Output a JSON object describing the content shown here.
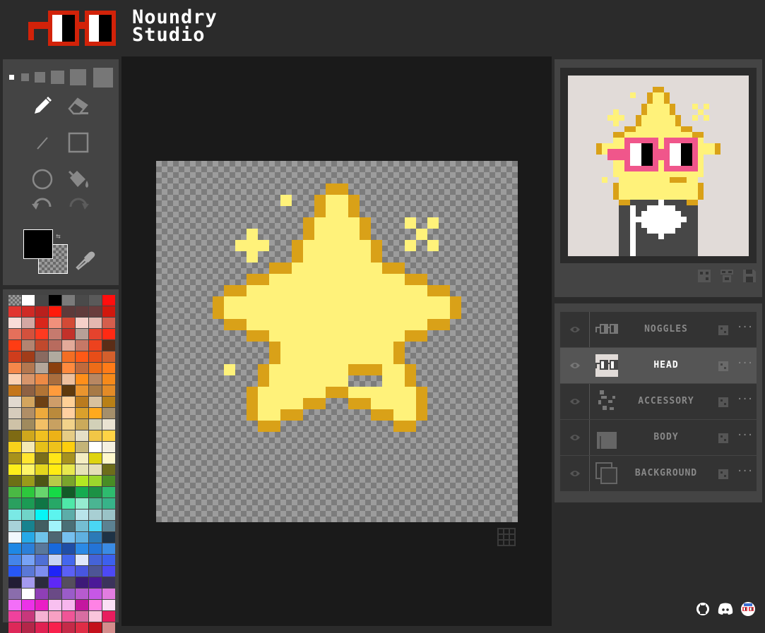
{
  "app": {
    "logo_line1": "Noundry",
    "logo_line2": "Studio",
    "logo_icon": "noggles-logo"
  },
  "toolbox": {
    "brush_sizes": 6,
    "selected_brush_size": 1,
    "tools": [
      "pencil-icon",
      "eraser-icon",
      "line-icon",
      "rectangle-icon",
      "circle-icon",
      "fill-bucket-icon",
      "undo-icon",
      "redo-icon"
    ],
    "selected_tool": "pencil-icon",
    "primary_color": "#000000",
    "secondary_color": "transparent"
  },
  "palette": {
    "colors": [
      "transparent",
      "#ffffff",
      "#474747",
      "#000000",
      "#7b7b7b",
      "#4a4a4a",
      "#5a5a5a",
      "#ff0e0e",
      "#e1352f",
      "#cf2a25",
      "#b9201d",
      "#ff1a0b",
      "#5d3a3a",
      "#603b3b",
      "#6a3c3c",
      "#d1180d",
      "#f8ddd8",
      "#d4a8a3",
      "#d9261b",
      "#f0907b",
      "#d34a36",
      "#f6d0c9",
      "#e4b8b0",
      "#d55e4d",
      "#e5705b",
      "#d3513d",
      "#ff3a20",
      "#c67a6e",
      "#c3312a",
      "#b7a097",
      "#e5432d",
      "#ff2a14",
      "#ff3c13",
      "#b38471",
      "#c1492d",
      "#b86b5e",
      "#e3aa99",
      "#c67866",
      "#ed421e",
      "#5b2d17",
      "#cf3d1c",
      "#a23c19",
      "#8a6a60",
      "#b0aa9f",
      "#f36e24",
      "#ff5917",
      "#e74d18",
      "#d35f2c",
      "#f5884a",
      "#b4774f",
      "#b4a69a",
      "#8a3f0e",
      "#ff8a3e",
      "#c16a3c",
      "#ed6c18",
      "#ff7b18",
      "#fbd1b4",
      "#d7956b",
      "#ed8a45",
      "#aa6e3e",
      "#eec09d",
      "#ff8f1a",
      "#b88762",
      "#f68a1a",
      "#c4761b",
      "#8e6143",
      "#b27435",
      "#ff9b3c",
      "#5f3a0d",
      "#ea952e",
      "#a77a46",
      "#e38b27",
      "#e1d9cf",
      "#d3a55e",
      "#6d4014",
      "#ce9d69",
      "#ffd096",
      "#ba7b1e",
      "#d8c19f",
      "#b98017",
      "#d6ccbc",
      "#b08e66",
      "#edaa3c",
      "#ba8a3c",
      "#ffd0a0",
      "#d9a02c",
      "#ffa91e",
      "#a58f6b",
      "#cec2a7",
      "#a08a5d",
      "#f2c066",
      "#c8a161",
      "#f2d28a",
      "#cbaa5b",
      "#d2d0b8",
      "#e9e2d1",
      "#7e6a13",
      "#cfa71d",
      "#f0c020",
      "#edb217",
      "#e6cc85",
      "#e5dfc7",
      "#f2c646",
      "#ffd345",
      "#f8d11b",
      "#f5e9b4",
      "#e5c019",
      "#eec21b",
      "#fdce0e",
      "#c4b478",
      "#ffffff",
      "#f5f0e0",
      "#a8921b",
      "#ffe52f",
      "#7a6e1a",
      "#ffe617",
      "#a7921f",
      "#f4edc2",
      "#dfd410",
      "#fff8cc",
      "#fdee1a",
      "#fff569",
      "#e4d61d",
      "#ffec12",
      "#e8e84e",
      "#e6e3b7",
      "#e6dfb8",
      "#6d6d1a",
      "#6d6f15",
      "#9a9a1a",
      "#4e5614",
      "#b8ca48",
      "#79a42c",
      "#b2e823",
      "#9cd72d",
      "#488d25",
      "#4ab944",
      "#2dc83d",
      "#67d66d",
      "#16da46",
      "#125b27",
      "#15ab50",
      "#1c9145",
      "#2ebb6e",
      "#2aa05f",
      "#1b9b54",
      "#0f7645",
      "#27a867",
      "#4ee8a8",
      "#95ebd0",
      "#4ab592",
      "#37b389",
      "#7ae9e5",
      "#70d4c8",
      "#05f6f6",
      "#5cf4ee",
      "#5cada9",
      "#b9e4ea",
      "#a8cfd3",
      "#9ac3c7",
      "#a8d2d9",
      "#17838f",
      "#425e61",
      "#a1f3fb",
      "#4a6f76",
      "#74bed3",
      "#4ad6f4",
      "#5c8292",
      "#f1f8fd",
      "#26a9e7",
      "#6ec3e9",
      "#4e6672",
      "#76c0ef",
      "#5fb0e0",
      "#2b7ab7",
      "#1e3245",
      "#1e88e5",
      "#2b7fd9",
      "#59789c",
      "#1869dc",
      "#1f4ea6",
      "#2b8ae6",
      "#2474d7",
      "#3a8be4",
      "#4484e9",
      "#77a2f6",
      "#4f6fd5",
      "#c6d3f4",
      "#4467ee",
      "#e0e8fb",
      "#4563d7",
      "#3c60ed",
      "#2757f5",
      "#5a78d7",
      "#7d8ef0",
      "#1e24f7",
      "#5b60f5",
      "#4856e0",
      "#4d5596",
      "#4d49f4",
      "#221d35",
      "#a49aef",
      "#2b2b3d",
      "#5e28f7",
      "#554e5d",
      "#3d1a78",
      "#4b1998",
      "#3b335b",
      "#8a6dac",
      "#fffeff",
      "#8f3fb6",
      "#6a4a86",
      "#9a5cc9",
      "#b65bcf",
      "#c657e5",
      "#e27de0",
      "#f36ef8",
      "#eb32e8",
      "#ea1ec5",
      "#f8c0f0",
      "#f7b6ee",
      "#c4179f",
      "#ff82e5",
      "#fbe0f5",
      "#f0419d",
      "#c8377c",
      "#f6b2d3",
      "#f8a0c3",
      "#f05597",
      "#d86da2",
      "#f9c5dc",
      "#e81c5e",
      "#dd2859",
      "#b32649",
      "#e02152",
      "#f8204c",
      "#c52a48",
      "#df2d46",
      "#c4101c",
      "#d48c8c"
    ]
  },
  "stage": {
    "grid_toggle_icon": "grid-icon"
  },
  "preview": {
    "actions": [
      "randomize-icon",
      "noggles-blueprint-icon",
      "save-icon"
    ]
  },
  "layers": [
    {
      "name": "NOGGLES",
      "active": false
    },
    {
      "name": "HEAD",
      "active": true
    },
    {
      "name": "ACCESSORY",
      "active": false
    },
    {
      "name": "BODY",
      "active": false
    },
    {
      "name": "BACKGROUND",
      "active": false
    }
  ],
  "footer": {
    "icons": [
      "github-icon",
      "discord-icon",
      "nouns-icon"
    ]
  }
}
